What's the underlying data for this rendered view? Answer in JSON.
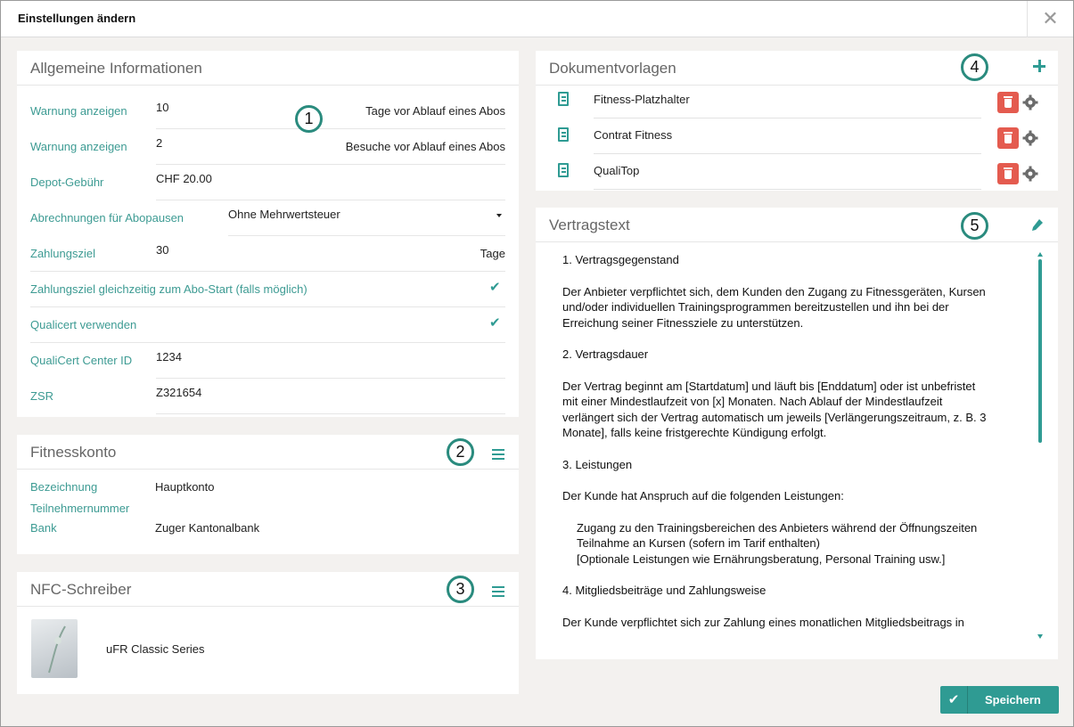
{
  "dialog": {
    "title": "Einstellungen ändern",
    "close_glyph": "✕"
  },
  "general": {
    "title": "Allgemeine Informationen",
    "warn_days_label": "Warnung anzeigen",
    "warn_days_value": "10",
    "warn_days_suffix": "Tage vor Ablauf eines Abos",
    "warn_visits_label": "Warnung anzeigen",
    "warn_visits_value": "2",
    "warn_visits_suffix": "Besuche vor Ablauf eines Abos",
    "deposit_label": "Depot-Gebühr",
    "deposit_value": "CHF 20.00",
    "billing_label": "Abrechnungen für Abopausen",
    "billing_value": "Ohne Mehrwertsteuer",
    "payment_label": "Zahlungsziel",
    "payment_value": "30",
    "payment_suffix": "Tage",
    "payment_start_label": "Zahlungsziel gleichzeitig zum Abo-Start (falls möglich)",
    "payment_start_checked": true,
    "qualicert_label": "Qualicert verwenden",
    "qualicert_checked": true,
    "center_id_label": "QualiCert Center ID",
    "center_id_value": "1234",
    "zsr_label": "ZSR",
    "zsr_value": "Z321654"
  },
  "account": {
    "title": "Fitnesskonto",
    "name_label": "Bezeichnung",
    "name_value": "Hauptkonto",
    "participant_label": "Teilnehmernummer",
    "participant_value": "",
    "bank_label": "Bank",
    "bank_value": "Zuger Kantonalbank"
  },
  "nfc": {
    "title": "NFC-Schreiber",
    "device": "uFR Classic Series"
  },
  "templates": {
    "title": "Dokumentvorlagen",
    "items": [
      {
        "name": "Fitness-Platzhalter"
      },
      {
        "name": "Contrat Fitness"
      },
      {
        "name": "QualiTop"
      }
    ]
  },
  "contract": {
    "title": "Vertragstext",
    "p1": "1. Vertragsgegenstand",
    "p2a": "Der Anbieter verpflichtet sich, dem Kunden den Zugang zu Fitnessgeräten, Kursen",
    "p2b": "und/oder individuellen Trainingsprogrammen bereitzustellen und ihn bei der",
    "p2c": "Erreichung seiner Fitnessziele zu unterstützen.",
    "p3": "2. Vertragsdauer",
    "p4a": "Der Vertrag beginnt am [Startdatum] und läuft bis [Enddatum] oder ist unbefristet",
    "p4b": "mit einer Mindestlaufzeit von [x] Monaten. Nach Ablauf der Mindestlaufzeit",
    "p4c": "verlängert sich der Vertrag automatisch um jeweils [Verlängerungszeitraum, z. B. 3",
    "p4d": "Monate], falls keine fristgerechte Kündigung erfolgt.",
    "p5": "3. Leistungen",
    "p6": "Der Kunde hat Anspruch auf die folgenden Leistungen:",
    "l1": "Zugang zu den Trainingsbereichen des Anbieters während der Öffnungszeiten",
    "l2": "Teilnahme an Kursen (sofern im Tarif enthalten)",
    "l3": "[Optionale Leistungen wie Ernährungsberatung, Personal Training usw.]",
    "p7": "4. Mitgliedsbeiträge und Zahlungsweise",
    "p8": "Der Kunde verpflichtet sich zur Zahlung eines monatlichen Mitgliedsbeitrags in"
  },
  "markers": {
    "m1": "1",
    "m2": "2",
    "m3": "3",
    "m4": "4",
    "m5": "5"
  },
  "footer": {
    "save_label": "Speichern"
  },
  "colors": {
    "accent": "#2f9b93",
    "danger": "#e45b4f",
    "marker_ring": "#2a8b7e"
  }
}
